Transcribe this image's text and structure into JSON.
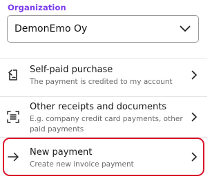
{
  "organization": {
    "label": "Organization",
    "selected": "DemonEmo Oy",
    "chevron_icon": "chevron-down-icon"
  },
  "items": [
    {
      "title": "Self-paid purchase",
      "subtitle": "The payment is credited to my account",
      "icon": "receipt-return-icon"
    },
    {
      "title": "Other receipts and documents",
      "subtitle": "E.g. company credit card payments, other paid payments",
      "icon": "scan-document-icon"
    },
    {
      "title": "New payment",
      "subtitle": "Create new invoice payment",
      "icon": "arrow-right-icon"
    }
  ],
  "colors": {
    "accent": "#7c3aed",
    "highlight": "#d9152b",
    "text": "#1a1a1a",
    "muted": "#6b6b6b"
  }
}
